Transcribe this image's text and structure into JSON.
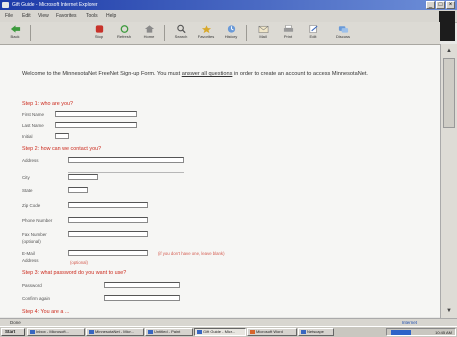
{
  "window": {
    "title": "Gift Guide - Microsoft Internet Explorer"
  },
  "menu": [
    "File",
    "Edit",
    "View",
    "Favorites",
    "Tools",
    "Help"
  ],
  "address": {
    "label": "Address",
    "value": "http://www.minnesotanet.org/signup.htm",
    "go": "Go"
  },
  "toolbar": [
    {
      "label": "Back",
      "icon": "back-arrow-icon"
    },
    {
      "label": "Stop",
      "icon": "stop-icon"
    },
    {
      "label": "Refresh",
      "icon": "refresh-icon"
    },
    {
      "label": "Home",
      "icon": "home-icon"
    },
    {
      "label": "Search",
      "icon": "search-icon"
    },
    {
      "label": "Favorites",
      "icon": "favorites-icon"
    },
    {
      "label": "History",
      "icon": "history-icon"
    },
    {
      "label": "Mail",
      "icon": "mail-icon"
    },
    {
      "label": "Print",
      "icon": "print-icon"
    },
    {
      "label": "Edit",
      "icon": "edit-icon"
    },
    {
      "label": "Discuss",
      "icon": "discuss-icon"
    }
  ],
  "page": {
    "intro_a": "Welcome to the MinnesotaNet FreeNet Sign-up Form. You must ",
    "intro_link": "answer all questions",
    "intro_b": " in order to create an account to access MinnesotaNet.",
    "step1": "Step 1: who are you?",
    "step1_fields": [
      "First Name",
      "Last Name",
      "Initial"
    ],
    "step2": "Step 2: how can we contact you?",
    "step2_fields": [
      "Address",
      "City",
      "State",
      "Zip Code",
      "Phone Number",
      "Fax Number (optional)",
      "E-Mail Address"
    ],
    "email_hint": "(if you don't have one, leave blank)",
    "email_hint2": "(optional)",
    "step3": "Step 3: what password do you want to use?",
    "step3_fields": [
      "Password",
      "Confirm again"
    ],
    "step4": "Step 4: You are a ..."
  },
  "status": {
    "text": "Done",
    "zone": "Internet"
  },
  "taskbar": {
    "start": "Start",
    "tasks": [
      "Inbox - Microsoft...",
      "MinnesotaNet - Micr...",
      "Untitled - Paint",
      "Gift Guide - Micr...",
      "Microsoft Word",
      "Netscape"
    ],
    "clock": "10:45 AM"
  },
  "colors": {
    "accent": "#cc2b1e",
    "titlebar": "#1c3aa8"
  }
}
